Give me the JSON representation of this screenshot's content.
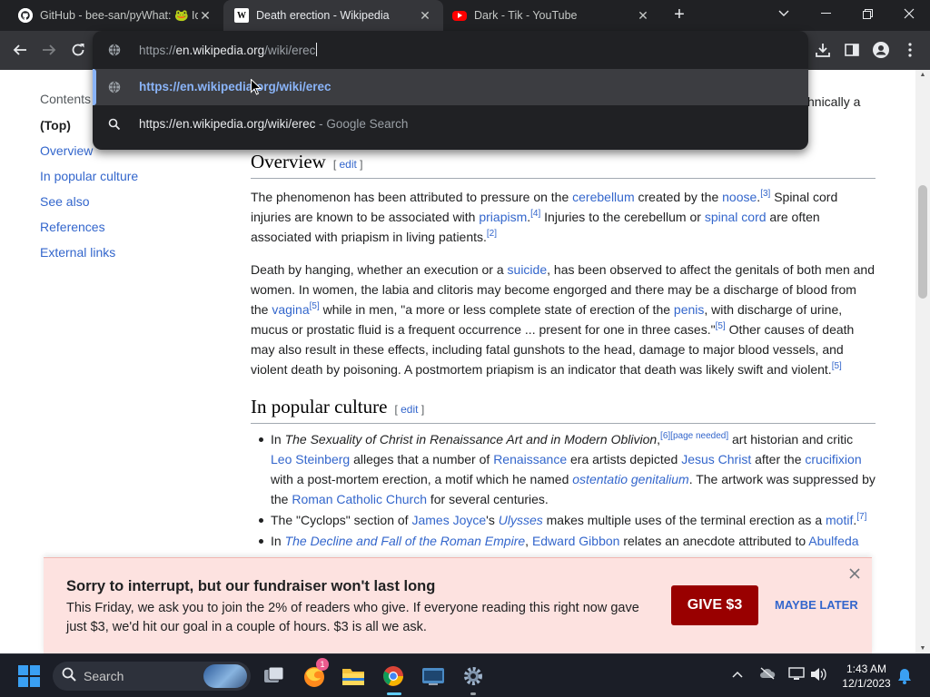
{
  "browser": {
    "tabs": [
      {
        "title": "GitHub - bee-san/pyWhat: 🐸 Id",
        "icon": "github-icon"
      },
      {
        "title": "Death erection - Wikipedia",
        "icon": "wikipedia-icon"
      },
      {
        "title": "Dark - Tik - YouTube",
        "icon": "youtube-icon"
      }
    ],
    "omnibox": {
      "url_prefix": "https://",
      "url_host": "en.wikipedia.org",
      "url_path": "/wiki/erec",
      "suggestions": [
        {
          "text": "https://en.wikipedia.org/wiki/erec",
          "suffix": "",
          "icon": "globe-icon"
        },
        {
          "text": "https://en.wikipedia.org/wiki/erec",
          "suffix": " - Google Search",
          "icon": "search-icon"
        }
      ]
    }
  },
  "page": {
    "clipped_text": "hnically a",
    "toc": {
      "title": "Contents",
      "items": [
        "(Top)",
        "Overview",
        "In popular culture",
        "See also",
        "References",
        "External links"
      ]
    },
    "overview": {
      "heading": "Overview",
      "edit": "edit",
      "p1": {
        "t1": "The phenomenon has been attributed to pressure on the ",
        "l1": "cerebellum",
        "t2": " created by the ",
        "l2": "noose",
        "t3": ".",
        "s1": "[3]",
        "t4": " Spinal cord injuries are known to be associated with ",
        "l3": "priapism",
        "t5": ".",
        "s2": "[4]",
        "t6": " Injuries to the cerebellum or ",
        "l4": "spinal cord",
        "t7": " are often associated with priapism in living patients.",
        "s3": "[2]"
      },
      "p2": {
        "t1": "Death by hanging, whether an execution or a ",
        "l1": "suicide",
        "t2": ", has been observed to affect the genitals of both men and women. In women, the labia and clitoris may become engorged and there may be a discharge of blood from the ",
        "l2": "vagina",
        "s1": "[5]",
        "t3": " while in men, \"a more or less complete state of erection of the ",
        "l3": "penis",
        "t4": ", with discharge of urine, mucus or prostatic fluid is a frequent occurrence ... present for one in three cases.\"",
        "s2": "[5]",
        "t5": " Other causes of death may also result in these effects, including fatal gunshots to the head, damage to major blood vessels, and violent death by poisoning. A postmortem priapism is an indicator that death was likely swift and violent.",
        "s3": "[5]"
      }
    },
    "culture": {
      "heading": "In popular culture",
      "edit": "edit",
      "li1": {
        "t1": "In ",
        "i1": "The Sexuality of Christ in Renaissance Art and in Modern Oblivion",
        "t2": ",",
        "s1": "[6][page needed]",
        "t3": " art historian and critic ",
        "l1": "Leo Steinberg",
        "t4": " alleges that a number of ",
        "l2": "Renaissance",
        "t5": " era artists depicted ",
        "l3": "Jesus Christ",
        "t6": " after the ",
        "l4": "crucifixion",
        "t7": " with a post-mortem erection, a motif which he named ",
        "l5": "ostentatio genitalium",
        "t8": ". The artwork was suppressed by the ",
        "l6": "Roman Catholic Church",
        "t9": " for several centuries."
      },
      "li2": {
        "t1": "The \"Cyclops\" section of ",
        "l1": "James Joyce",
        "t2": "'s ",
        "l2": "Ulysses",
        "t3": " makes multiple uses of the terminal erection as a ",
        "l3": "motif",
        "t4": ".",
        "s1": "[7]"
      },
      "li3": {
        "t1": "In ",
        "l1": "The Decline and Fall of the Roman Empire",
        "t2": ", ",
        "l2": "Edward Gibbon",
        "t3": " relates an anecdote attributed to ",
        "l3": "Abulfeda"
      }
    },
    "banner": {
      "title": "Sorry to interrupt, but our fundraiser won't last long",
      "message": "This Friday, we ask you to join the 2% of readers who give. If everyone reading this right now gave just $3, we'd hit our goal in a couple of hours. $3 is all we ask.",
      "give_label": "GIVE $3",
      "maybe_label": "MAYBE LATER"
    }
  },
  "taskbar": {
    "search_label": "Search",
    "notification_count": "1",
    "time": "1:43 AM",
    "date": "12/1/2023"
  },
  "colors": {
    "link": "#3366cc",
    "donate": "#990000",
    "banner_bg": "#fde2e0",
    "omnibox_link": "#8ab4f8"
  }
}
